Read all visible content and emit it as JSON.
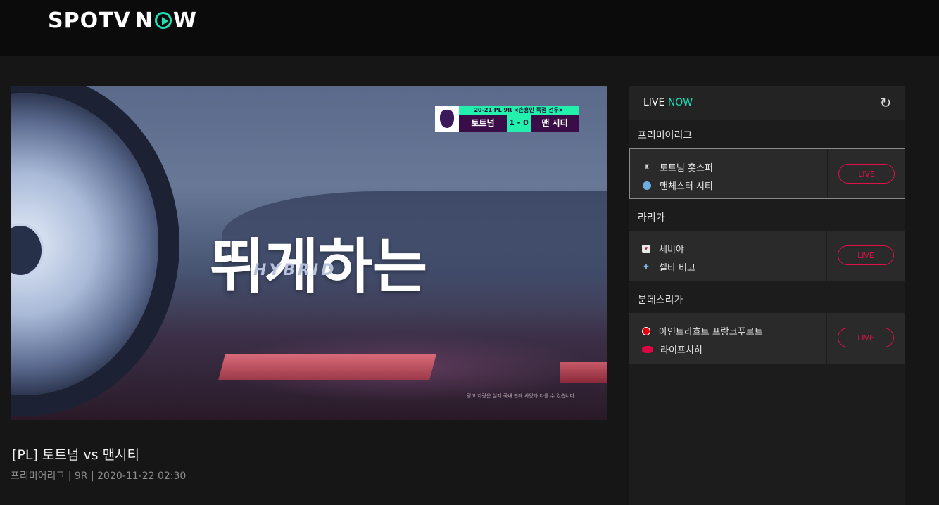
{
  "header": {
    "logo_text_left": "SPOTV",
    "logo_text_right_a": "N",
    "logo_text_right_b": "W",
    "logo_icon": "play-circle-icon"
  },
  "player": {
    "scoreboard": {
      "match_info": "20-21 PL 9R <손흥민 득점 선두>",
      "home": "토트넘",
      "result": "1 - 0",
      "away": "맨 시티"
    },
    "caption": "뛰게하는",
    "brand_mark": "HYBRID",
    "disclaimer": "광고 차량은 실제 국내 판매 사양과 다를 수 있습니다"
  },
  "video_info": {
    "title": "[PL] 토트넘 vs 맨시티",
    "meta": "프리미어리그 | 9R | 2020-11-22 02:30"
  },
  "live_panel": {
    "title_a": "LIVE",
    "title_b": "NOW",
    "refresh_icon": "refresh-icon",
    "accent_color": "#1fe0b4",
    "live_color": "#e0114a",
    "leagues": [
      {
        "name": "프리미어리그",
        "home": "토트넘 홋스퍼",
        "away": "맨체스터 시티",
        "button": "LIVE"
      },
      {
        "name": "라리가",
        "home": "세비야",
        "away": "셀타 비고",
        "button": "LIVE"
      },
      {
        "name": "분데스리가",
        "home": "아인트라흐트 프랑크푸르트",
        "away": "라이프치히",
        "button": "LIVE"
      }
    ]
  }
}
